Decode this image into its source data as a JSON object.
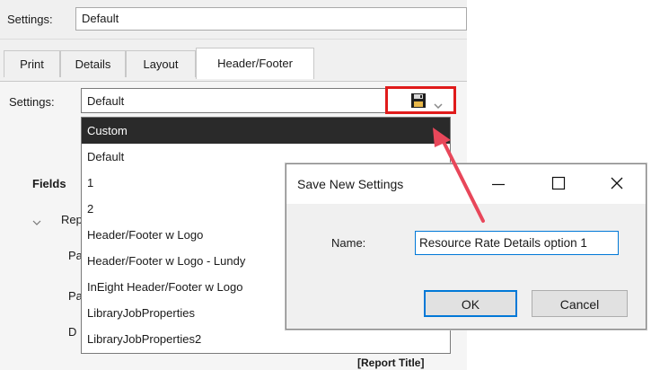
{
  "top": {
    "settings_label": "Settings:",
    "settings_value": "Default"
  },
  "tabs": [
    {
      "label": "Print"
    },
    {
      "label": "Details"
    },
    {
      "label": "Layout"
    },
    {
      "label": "Header/Footer"
    }
  ],
  "active_tab": "Header/Footer",
  "panel": {
    "settings_label": "Settings:",
    "settings_value": "Default",
    "save_icon": "floppy-disk-icon",
    "dropdown_icon": "chevron-down-icon",
    "fields_label": "Fields",
    "tree_items": [
      "Repo",
      "Pa",
      "Pa",
      "D"
    ],
    "report_title_fragment": "[Report Title]"
  },
  "dropdown_options": [
    "Custom",
    "Default",
    "1",
    "2",
    "Header/Footer w Logo",
    "Header/Footer w Logo - Lundy",
    "InEight Header/Footer w Logo",
    "LibraryJobProperties",
    "LibraryJobProperties2"
  ],
  "selected_option": "Custom",
  "dialog": {
    "title": "Save New Settings",
    "name_label": "Name:",
    "name_value": "Resource Rate Details option 1",
    "ok_label": "OK",
    "cancel_label": "Cancel",
    "minimize_icon": "minimize-icon",
    "maximize_icon": "maximize-icon",
    "close_icon": "close-icon"
  },
  "colors": {
    "highlight": "#e01b1b",
    "arrow": "#e8475a",
    "selected_bg": "#2a2a2a",
    "focus": "#0078d7"
  }
}
